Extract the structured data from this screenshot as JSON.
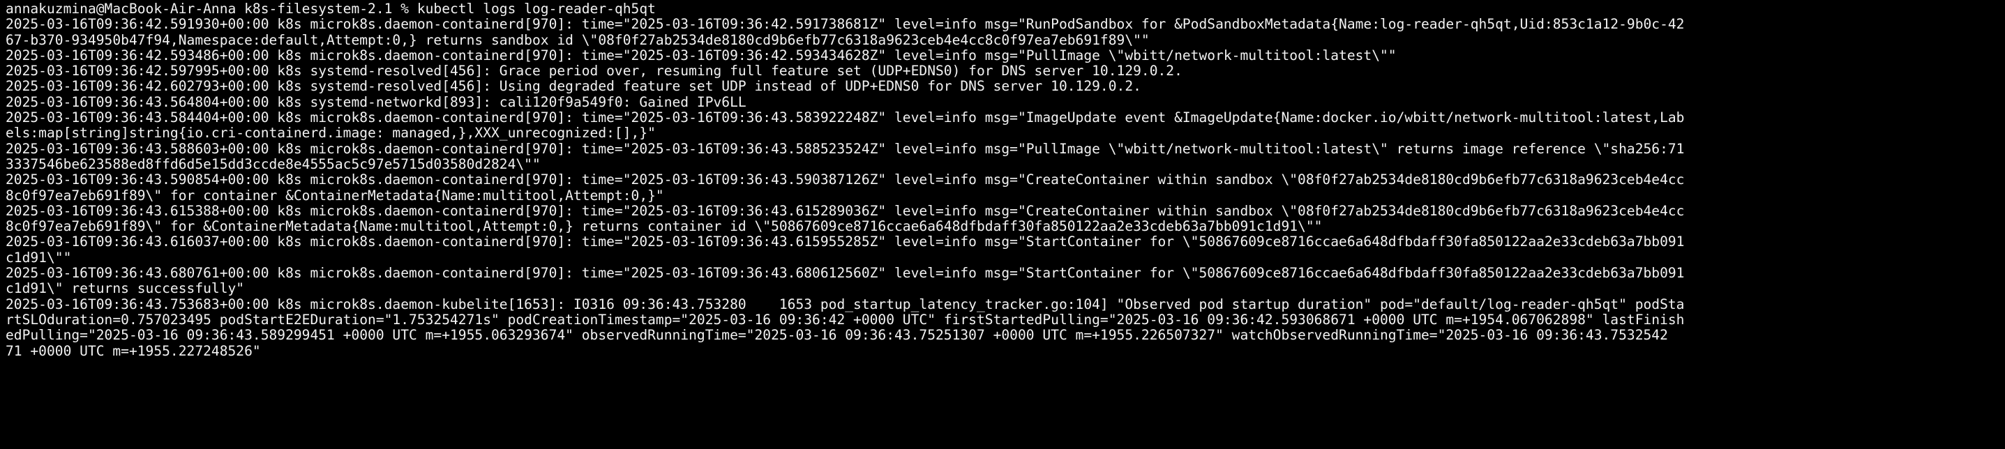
{
  "terminal": {
    "prompt": "annakuzmina@MacBook-Air-Anna k8s-filesystem-2.1 % ",
    "command": "kubectl logs log-reader-qh5qt",
    "lines": [
      "2025-03-16T09:36:42.591930+00:00 k8s microk8s.daemon-containerd[970]: time=\"2025-03-16T09:36:42.591738681Z\" level=info msg=\"RunPodSandbox for &PodSandboxMetadata{Name:log-reader-qh5qt,Uid:853c1a12-9b0c-42",
      "67-b370-934950b47f94,Namespace:default,Attempt:0,} returns sandbox id \\\"08f0f27ab2534de8180cd9b6efb77c6318a9623ceb4e4cc8c0f97ea7eb691f89\\\"\"",
      "2025-03-16T09:36:42.593486+00:00 k8s microk8s.daemon-containerd[970]: time=\"2025-03-16T09:36:42.593434628Z\" level=info msg=\"PullImage \\\"wbitt/network-multitool:latest\\\"\"",
      "2025-03-16T09:36:42.597995+00:00 k8s systemd-resolved[456]: Grace period over, resuming full feature set (UDP+EDNS0) for DNS server 10.129.0.2.",
      "2025-03-16T09:36:42.602793+00:00 k8s systemd-resolved[456]: Using degraded feature set UDP instead of UDP+EDNS0 for DNS server 10.129.0.2.",
      "2025-03-16T09:36:43.564804+00:00 k8s systemd-networkd[893]: cali120f9a549f0: Gained IPv6LL",
      "2025-03-16T09:36:43.584404+00:00 k8s microk8s.daemon-containerd[970]: time=\"2025-03-16T09:36:43.583922248Z\" level=info msg=\"ImageUpdate event &ImageUpdate{Name:docker.io/wbitt/network-multitool:latest,Lab",
      "els:map[string]string{io.cri-containerd.image: managed,},XXX_unrecognized:[],}\"",
      "2025-03-16T09:36:43.588603+00:00 k8s microk8s.daemon-containerd[970]: time=\"2025-03-16T09:36:43.588523524Z\" level=info msg=\"PullImage \\\"wbitt/network-multitool:latest\\\" returns image reference \\\"sha256:71",
      "3337546be623588ed8ffd6d5e15dd3ccde8e4555ac5c97e5715d03580d2824\\\"\"",
      "2025-03-16T09:36:43.590854+00:00 k8s microk8s.daemon-containerd[970]: time=\"2025-03-16T09:36:43.590387126Z\" level=info msg=\"CreateContainer within sandbox \\\"08f0f27ab2534de8180cd9b6efb77c6318a9623ceb4e4cc",
      "8c0f97ea7eb691f89\\\" for container &ContainerMetadata{Name:multitool,Attempt:0,}\"",
      "2025-03-16T09:36:43.615388+00:00 k8s microk8s.daemon-containerd[970]: time=\"2025-03-16T09:36:43.615289036Z\" level=info msg=\"CreateContainer within sandbox \\\"08f0f27ab2534de8180cd9b6efb77c6318a9623ceb4e4cc",
      "8c0f97ea7eb691f89\\\" for &ContainerMetadata{Name:multitool,Attempt:0,} returns container id \\\"50867609ce8716ccae6a648dfbdaff30fa850122aa2e33cdeb63a7bb091c1d91\\\"\"",
      "2025-03-16T09:36:43.616037+00:00 k8s microk8s.daemon-containerd[970]: time=\"2025-03-16T09:36:43.615955285Z\" level=info msg=\"StartContainer for \\\"50867609ce8716ccae6a648dfbdaff30fa850122aa2e33cdeb63a7bb091",
      "c1d91\\\"\"",
      "2025-03-16T09:36:43.680761+00:00 k8s microk8s.daemon-containerd[970]: time=\"2025-03-16T09:36:43.680612560Z\" level=info msg=\"StartContainer for \\\"50867609ce8716ccae6a648dfbdaff30fa850122aa2e33cdeb63a7bb091",
      "c1d91\\\" returns successfully\"",
      "2025-03-16T09:36:43.753683+00:00 k8s microk8s.daemon-kubelite[1653]: I0316 09:36:43.753280    1653 pod_startup_latency_tracker.go:104] \"Observed pod startup duration\" pod=\"default/log-reader-qh5qt\" podSta",
      "rtSLOduration=0.757023495 podStartE2EDuration=\"1.753254271s\" podCreationTimestamp=\"2025-03-16 09:36:42 +0000 UTC\" firstStartedPulling=\"2025-03-16 09:36:42.593068671 +0000 UTC m=+1954.067062898\" lastFinish",
      "edPulling=\"2025-03-16 09:36:43.589299451 +0000 UTC m=+1955.063293674\" observedRunningTime=\"2025-03-16 09:36:43.75251307 +0000 UTC m=+1955.226507327\" watchObservedRunningTime=\"2025-03-16 09:36:43.7532542",
      "71 +0000 UTC m=+1955.227248526\""
    ]
  }
}
